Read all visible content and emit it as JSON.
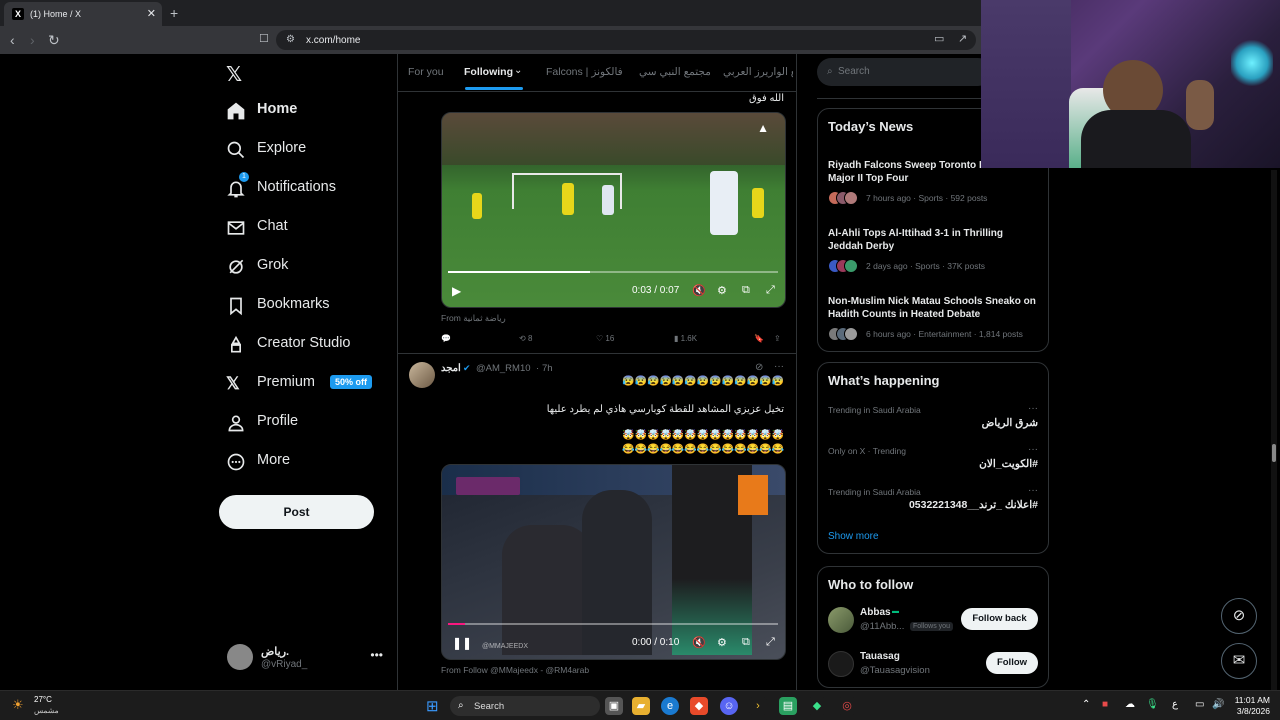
{
  "browser": {
    "tab_title": "(1) Home / X",
    "tab_close": "✕",
    "new_tab": "+",
    "url": "x.com/home"
  },
  "sidebar": {
    "items": [
      {
        "label": "Home",
        "icon": "home-icon"
      },
      {
        "label": "Explore",
        "icon": "search-icon"
      },
      {
        "label": "Notifications",
        "icon": "bell-icon",
        "badge": "1"
      },
      {
        "label": "Chat",
        "icon": "mail-icon"
      },
      {
        "label": "Grok",
        "icon": "grok-icon"
      },
      {
        "label": "Bookmarks",
        "icon": "bookmark-icon"
      },
      {
        "label": "Creator Studio",
        "icon": "creator-icon"
      },
      {
        "label": "Premium",
        "icon": "x-logo-icon",
        "badge": "50% off"
      },
      {
        "label": "Profile",
        "icon": "person-icon"
      },
      {
        "label": "More",
        "icon": "more-circle-icon"
      }
    ],
    "post_label": "Post",
    "profile": {
      "name": "رياض.",
      "handle": "@vRiyad_"
    }
  },
  "timeline": {
    "tabs": [
      "For you",
      "Following",
      "Falcons | فالكونز",
      "مجتمع النبي سي",
      "مجتمع الواريرز العربي",
      "مع الواريرز العربي"
    ],
    "active_tab": "Following"
  },
  "tweets": [
    {
      "text_top": "الله فوق",
      "video": {
        "time": "0:03 / 0:07",
        "progress": 0.43
      },
      "from": "From رياضة ثمانية",
      "actions": {
        "reply": "",
        "retweet": "8",
        "like": "16",
        "views": "1.6K"
      }
    },
    {
      "author": "امجد",
      "handle": "@AM_RM10",
      "time": "7h",
      "line1": "😰😰😰😰😰😰😰😰😰😰😰😰😰",
      "line2": "تخيل عزيزي المشاهد للقطة كوبارسي هاذي لم يطرد عليها",
      "line3": "🤯🤯🤯🤯🤯🤯🤯🤯🤯🤯🤯🤯🤯",
      "line4": "😂😂😂😂😂😂😂😂😂😂😂😂😂",
      "video": {
        "time": "0:00 / 0:10",
        "progress": 0.05,
        "watermark": "@MMAJEEDX"
      },
      "from": "From Follow @MMajeedx - @RM4arab"
    }
  ],
  "right": {
    "search_placeholder": "Search",
    "news": {
      "title": "Today’s News",
      "items": [
        {
          "title": "Riyadh Falcons Sweep Toronto KOI for CDL Major II Top Four",
          "meta": "7 hours ago · Sports · 592 posts"
        },
        {
          "title": "Al-Ahli Tops Al-Ittihad 3-1 in Thrilling Jeddah Derby",
          "meta": "2 days ago · Sports · 37K posts"
        },
        {
          "title": "Non-Muslim Nick Matau Schools Sneako on Hadith Counts in Heated Debate",
          "meta": "6 hours ago · Entertainment · 1,814 posts"
        }
      ]
    },
    "happening": {
      "title": "What’s happening",
      "items": [
        {
          "context": "Trending in Saudi Arabia",
          "name": "شرق الرياض"
        },
        {
          "context": "Only on X · Trending",
          "name": "#الكويت_الان"
        },
        {
          "context": "Trending in Saudi Arabia",
          "name": "#اعلانك _ترند__0532221348"
        }
      ],
      "show_more": "Show more"
    },
    "who_to_follow": {
      "title": "Who to follow",
      "items": [
        {
          "name": "Abbas",
          "handle": "@11Abb...",
          "follows_you": "Follows you",
          "button": "Follow back"
        },
        {
          "name": "Tauasag",
          "handle": "@Tauasagvision",
          "button": "Follow"
        }
      ]
    }
  },
  "taskbar": {
    "temp": "27°C",
    "weather": "مشمس",
    "search_placeholder": "Search",
    "time": "11:01 AM",
    "date": "3/8/2026",
    "lang": "ع"
  },
  "colors": {
    "accent": "#1d9bf0",
    "background": "#000000",
    "border": "#2f3336",
    "muted": "#71767b"
  }
}
